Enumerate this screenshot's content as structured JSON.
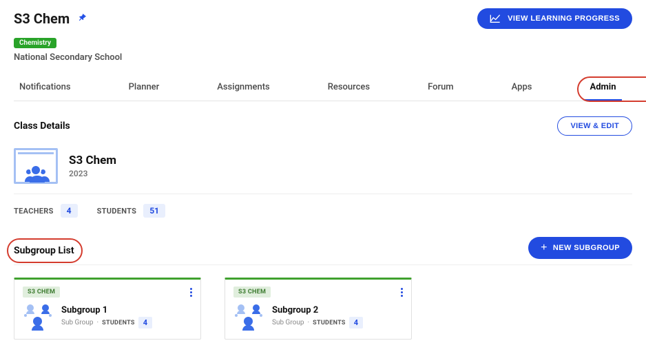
{
  "header": {
    "title": "S3 Chem",
    "progress_button": "VIEW LEARNING PROGRESS",
    "subject_badge": "Chemistry",
    "school": "National Secondary School"
  },
  "tabs": [
    {
      "label": "Notifications"
    },
    {
      "label": "Planner"
    },
    {
      "label": "Assignments"
    },
    {
      "label": "Resources"
    },
    {
      "label": "Forum"
    },
    {
      "label": "Apps"
    },
    {
      "label": "Admin"
    }
  ],
  "class_details": {
    "section_title": "Class Details",
    "view_edit": "VIEW & EDIT",
    "name": "S3 Chem",
    "year": "2023",
    "teachers_label": "TEACHERS",
    "teachers_count": "4",
    "students_label": "STUDENTS",
    "students_count": "51"
  },
  "subgroup": {
    "section_title": "Subgroup List",
    "new_button": "NEW SUBGROUP",
    "cards": [
      {
        "tag": "S3 CHEM",
        "name": "Subgroup 1",
        "type": "Sub Group",
        "students_label": "STUDENTS",
        "students_count": "4"
      },
      {
        "tag": "S3 CHEM",
        "name": "Subgroup 2",
        "type": "Sub Group",
        "students_label": "STUDENTS",
        "students_count": "4"
      }
    ]
  }
}
